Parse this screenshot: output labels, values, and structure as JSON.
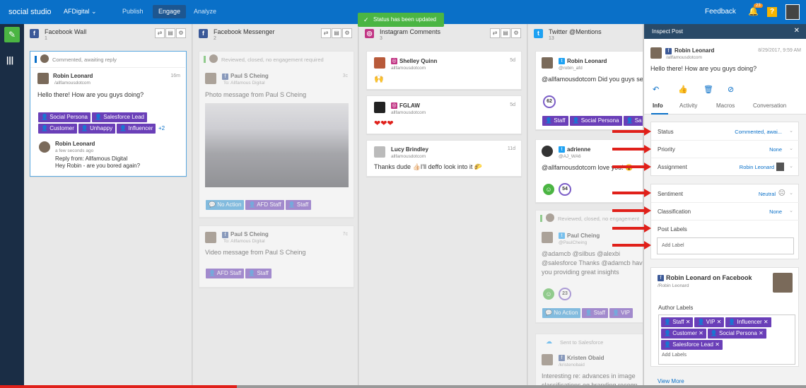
{
  "topbar": {
    "brand": "social studio",
    "org": "AFDigital",
    "tabs": [
      "Publish",
      "Engage",
      "Analyze"
    ],
    "active_tab": "Engage",
    "feedback": "Feedback",
    "notification_count": "23",
    "help": "?",
    "accent": "#0a70c8"
  },
  "toast": {
    "text": "Status has been updated",
    "color": "#4bb543"
  },
  "columns": [
    {
      "name": "Facebook Wall",
      "count": "1",
      "icon": "facebook-icon",
      "color": "#3b5998"
    },
    {
      "name": "Facebook Messenger",
      "count": "2",
      "icon": "facebook-icon",
      "color": "#3b5998"
    },
    {
      "name": "Instagram Comments",
      "count": "3",
      "icon": "instagram-icon",
      "color": "#c13584"
    },
    {
      "name": "Twitter @Mentions",
      "count": "13",
      "icon": "twitter-icon",
      "color": "#1da1f2"
    }
  ],
  "fb_wall": {
    "status": "Commented, awaiting reply",
    "author": "Robin Leonard",
    "handle": "/allfamousdotcom",
    "time": "16m",
    "message": "Hello there! How are you guys doing?",
    "tags": [
      "Social Persona",
      "Salesforce Lead",
      "Customer",
      "Unhappy",
      "Influencer"
    ],
    "more": "+2",
    "reply_author": "Robin Leonard",
    "reply_time": "a few seconds ago",
    "reply_from": "Reply from: Allfamous Digital",
    "reply_text": "Hey Robin - are you bored again?"
  },
  "fb_messenger": [
    {
      "status": "Reviewed, closed, no engagement required",
      "author": "Paul S Cheing",
      "handle": "To: Allfamous Digital",
      "time": "3c",
      "message": "Photo message from Paul S Cheing",
      "tags": [
        "No Action",
        "AFD Staff",
        "Staff"
      ]
    },
    {
      "author": "Paul S Cheing",
      "handle": "To: Allfamous Digital",
      "time": "7c",
      "message": "Video message from Paul S Cheing",
      "tags": [
        "AFD Staff",
        "Staff"
      ]
    }
  ],
  "instagram": [
    {
      "author": "Shelley Quinn",
      "handle": "allfamousdotcom",
      "time": "5d",
      "message": "🙌"
    },
    {
      "author": "FGLAW",
      "handle": "allfamousdotcom",
      "time": "5d",
      "message": "❤❤❤"
    },
    {
      "author": "Lucy Brindley",
      "handle": "allfamousdotcom",
      "time": "11d",
      "message": "Thanks dude 👍🏻I'll deffo look into it 🌮"
    }
  ],
  "twitter": [
    {
      "author": "Robin Leonard",
      "handle": "@robin_afd",
      "message": "@allfamousdotcom Did you guys se",
      "score": "62",
      "tags": [
        "Staff",
        "Social Persona",
        "Sa"
      ]
    },
    {
      "author": "adrienne",
      "handle": "@AJ_WA6",
      "message": "@allfamousdotcom love you! 😍",
      "score": "54"
    },
    {
      "status": "Reviewed, closed, no engagement",
      "author": "Paul Cheing",
      "handle": "@PaulCheing",
      "message": "@adamcb @silbus @alexbi @salesforce Thanks @adamcb have you providing great insights",
      "score": "23",
      "tags": [
        "No Action",
        "Staff",
        "VIP"
      ]
    },
    {
      "status": "Sent to Salesforce",
      "author": "Kristen Obaid",
      "handle": "/kristenobaid",
      "message": "Interesting re: advances in image classifications eg branding recogn"
    }
  ],
  "inspect": {
    "title": "Inspect Post",
    "author": "Robin Leonard",
    "handle": "/allfamousdotcom",
    "date": "8/29/2017, 9:59 AM",
    "message": "Hello there! How are you guys doing?",
    "tabs": [
      "Info",
      "Activity",
      "Macros",
      "Conversation"
    ],
    "fields": {
      "status_label": "Status",
      "status_value": "Commented, awai...",
      "priority_label": "Priority",
      "priority_value": "None",
      "assignment_label": "Assignment",
      "assignment_value": "Robin Leonard",
      "sentiment_label": "Sentiment",
      "sentiment_value": "Neutral",
      "classification_label": "Classification",
      "classification_value": "None",
      "post_labels": "Post Labels",
      "add_label_placeholder": "Add Label"
    },
    "author_box": {
      "title": "Robin Leonard on Facebook",
      "handle": "/Robin Leonard",
      "labels_title": "Author Labels",
      "labels": [
        "Staff",
        "VIP",
        "Influencer",
        "Customer",
        "Social Persona",
        "Salesforce Lead"
      ],
      "add_labels": "Add Labels",
      "view_more": "View More"
    }
  },
  "arrow_color": "#e0201a"
}
